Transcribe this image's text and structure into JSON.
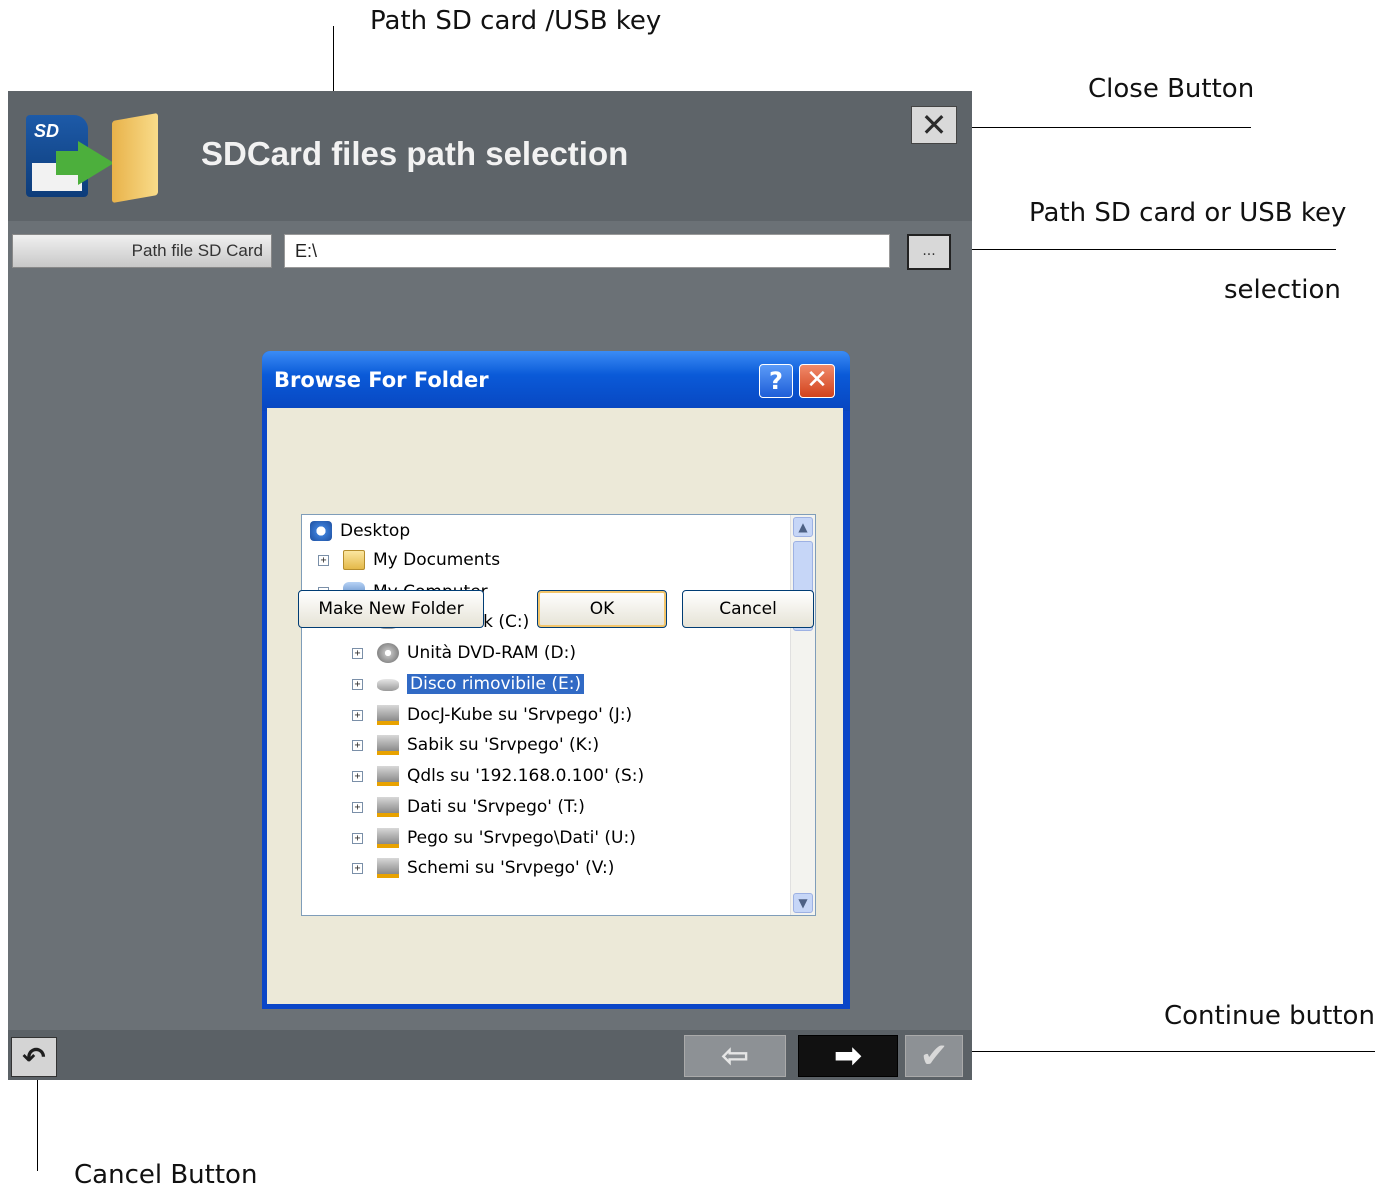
{
  "annotations": {
    "path_sd_usb": "Path SD card /USB key",
    "close_button": "Close Button",
    "path_selection_line1": "Path SD card or USB key",
    "path_selection_line2": "selection",
    "continue_button": "Continue button",
    "cancel_button": "Cancel Button"
  },
  "app": {
    "title": "SDCard files path selection",
    "icon_sd_text": "SD",
    "path_label": "Path file SD Card",
    "path_value": "E:\\",
    "browse_label": "...",
    "close_glyph": "✕",
    "cancel_glyph": "↶",
    "back_glyph": "⇦",
    "next_glyph": "➡",
    "confirm_glyph": "✔"
  },
  "dialog": {
    "title": "Browse For Folder",
    "help_label": "?",
    "close_label": "✕",
    "tree": [
      {
        "label": "Desktop",
        "icon": "desktop-icon",
        "expander": ""
      },
      {
        "label": "My Documents",
        "icon": "folder-icon",
        "expander": "+"
      },
      {
        "label": "My Computer",
        "icon": "computer-icon",
        "expander": "−"
      },
      {
        "label": "Local Disk (C:)",
        "icon": "disk-icon",
        "expander": "+"
      },
      {
        "label": "Unità DVD-RAM (D:)",
        "icon": "dvd-icon",
        "expander": "+"
      },
      {
        "label": "Disco rimovibile (E:)",
        "icon": "disk-icon",
        "expander": "+",
        "selected": true
      },
      {
        "label": "DocJ-Kube su 'Srvpego' (J:)",
        "icon": "network-drive-icon",
        "expander": "+"
      },
      {
        "label": "Sabik su 'Srvpego' (K:)",
        "icon": "network-drive-icon",
        "expander": "+"
      },
      {
        "label": "Qdls su '192.168.0.100' (S:)",
        "icon": "network-drive-icon",
        "expander": "+"
      },
      {
        "label": "Dati su 'Srvpego' (T:)",
        "icon": "network-drive-icon",
        "expander": "+"
      },
      {
        "label": "Pego su 'Srvpego\\Dati' (U:)",
        "icon": "network-drive-icon",
        "expander": "+"
      },
      {
        "label": "Schemi su 'Srvpego' (V:)",
        "icon": "network-drive-icon",
        "expander": "+"
      }
    ],
    "buttons": {
      "make_new_folder": "Make New Folder",
      "ok": "OK",
      "cancel": "Cancel"
    }
  },
  "colors": {
    "app_bg": "#6b7176",
    "xp_blue": "#0a46c8",
    "selection": "#316ac5"
  }
}
